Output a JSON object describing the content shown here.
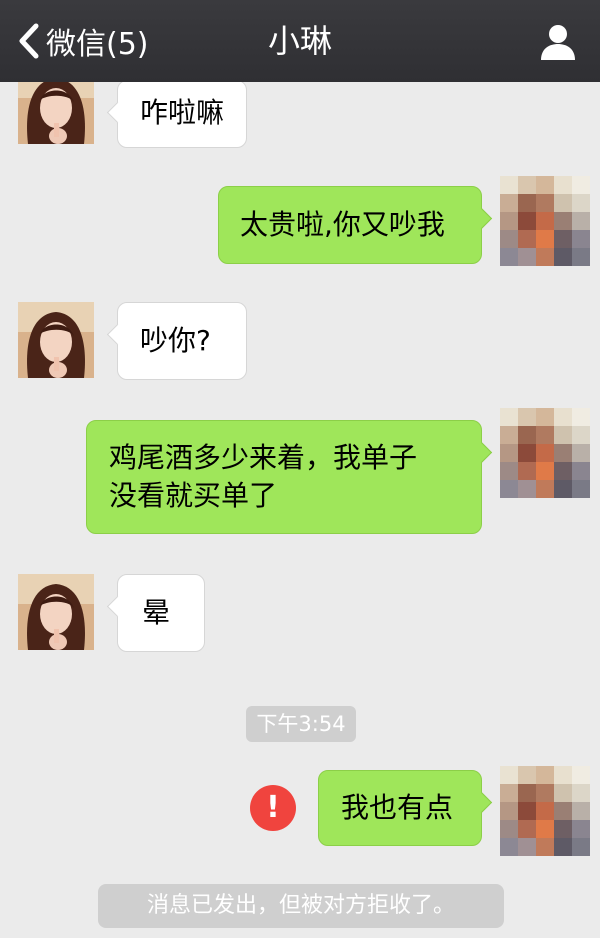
{
  "header": {
    "back_label": "微信(5)",
    "title": "小琳"
  },
  "messages": [
    {
      "side": "left",
      "text": "咋啦嘛"
    },
    {
      "side": "right",
      "text": "太贵啦,你又吵我"
    },
    {
      "side": "left",
      "text": "吵你?"
    },
    {
      "side": "right",
      "text": "鸡尾酒多少来着，我单子\n没看就买单了"
    },
    {
      "side": "left",
      "text": "晕"
    },
    {
      "side": "right",
      "text": "我也有点",
      "status": "failed"
    }
  ],
  "timestamp": "下午3:54",
  "error_icon": "!",
  "system_notice": "消息已发出，但被对方拒收了。",
  "colors": {
    "header_bg": "#333337",
    "chat_bg": "#ebebeb",
    "bubble_self": "#9fe65a",
    "bubble_other": "#ffffff",
    "error_red": "#f0443e",
    "pill_gray": "#cfcfcf"
  },
  "icons": {
    "back": "chevron-left-icon",
    "profile": "person-icon",
    "error": "exclamation-circle-icon"
  }
}
